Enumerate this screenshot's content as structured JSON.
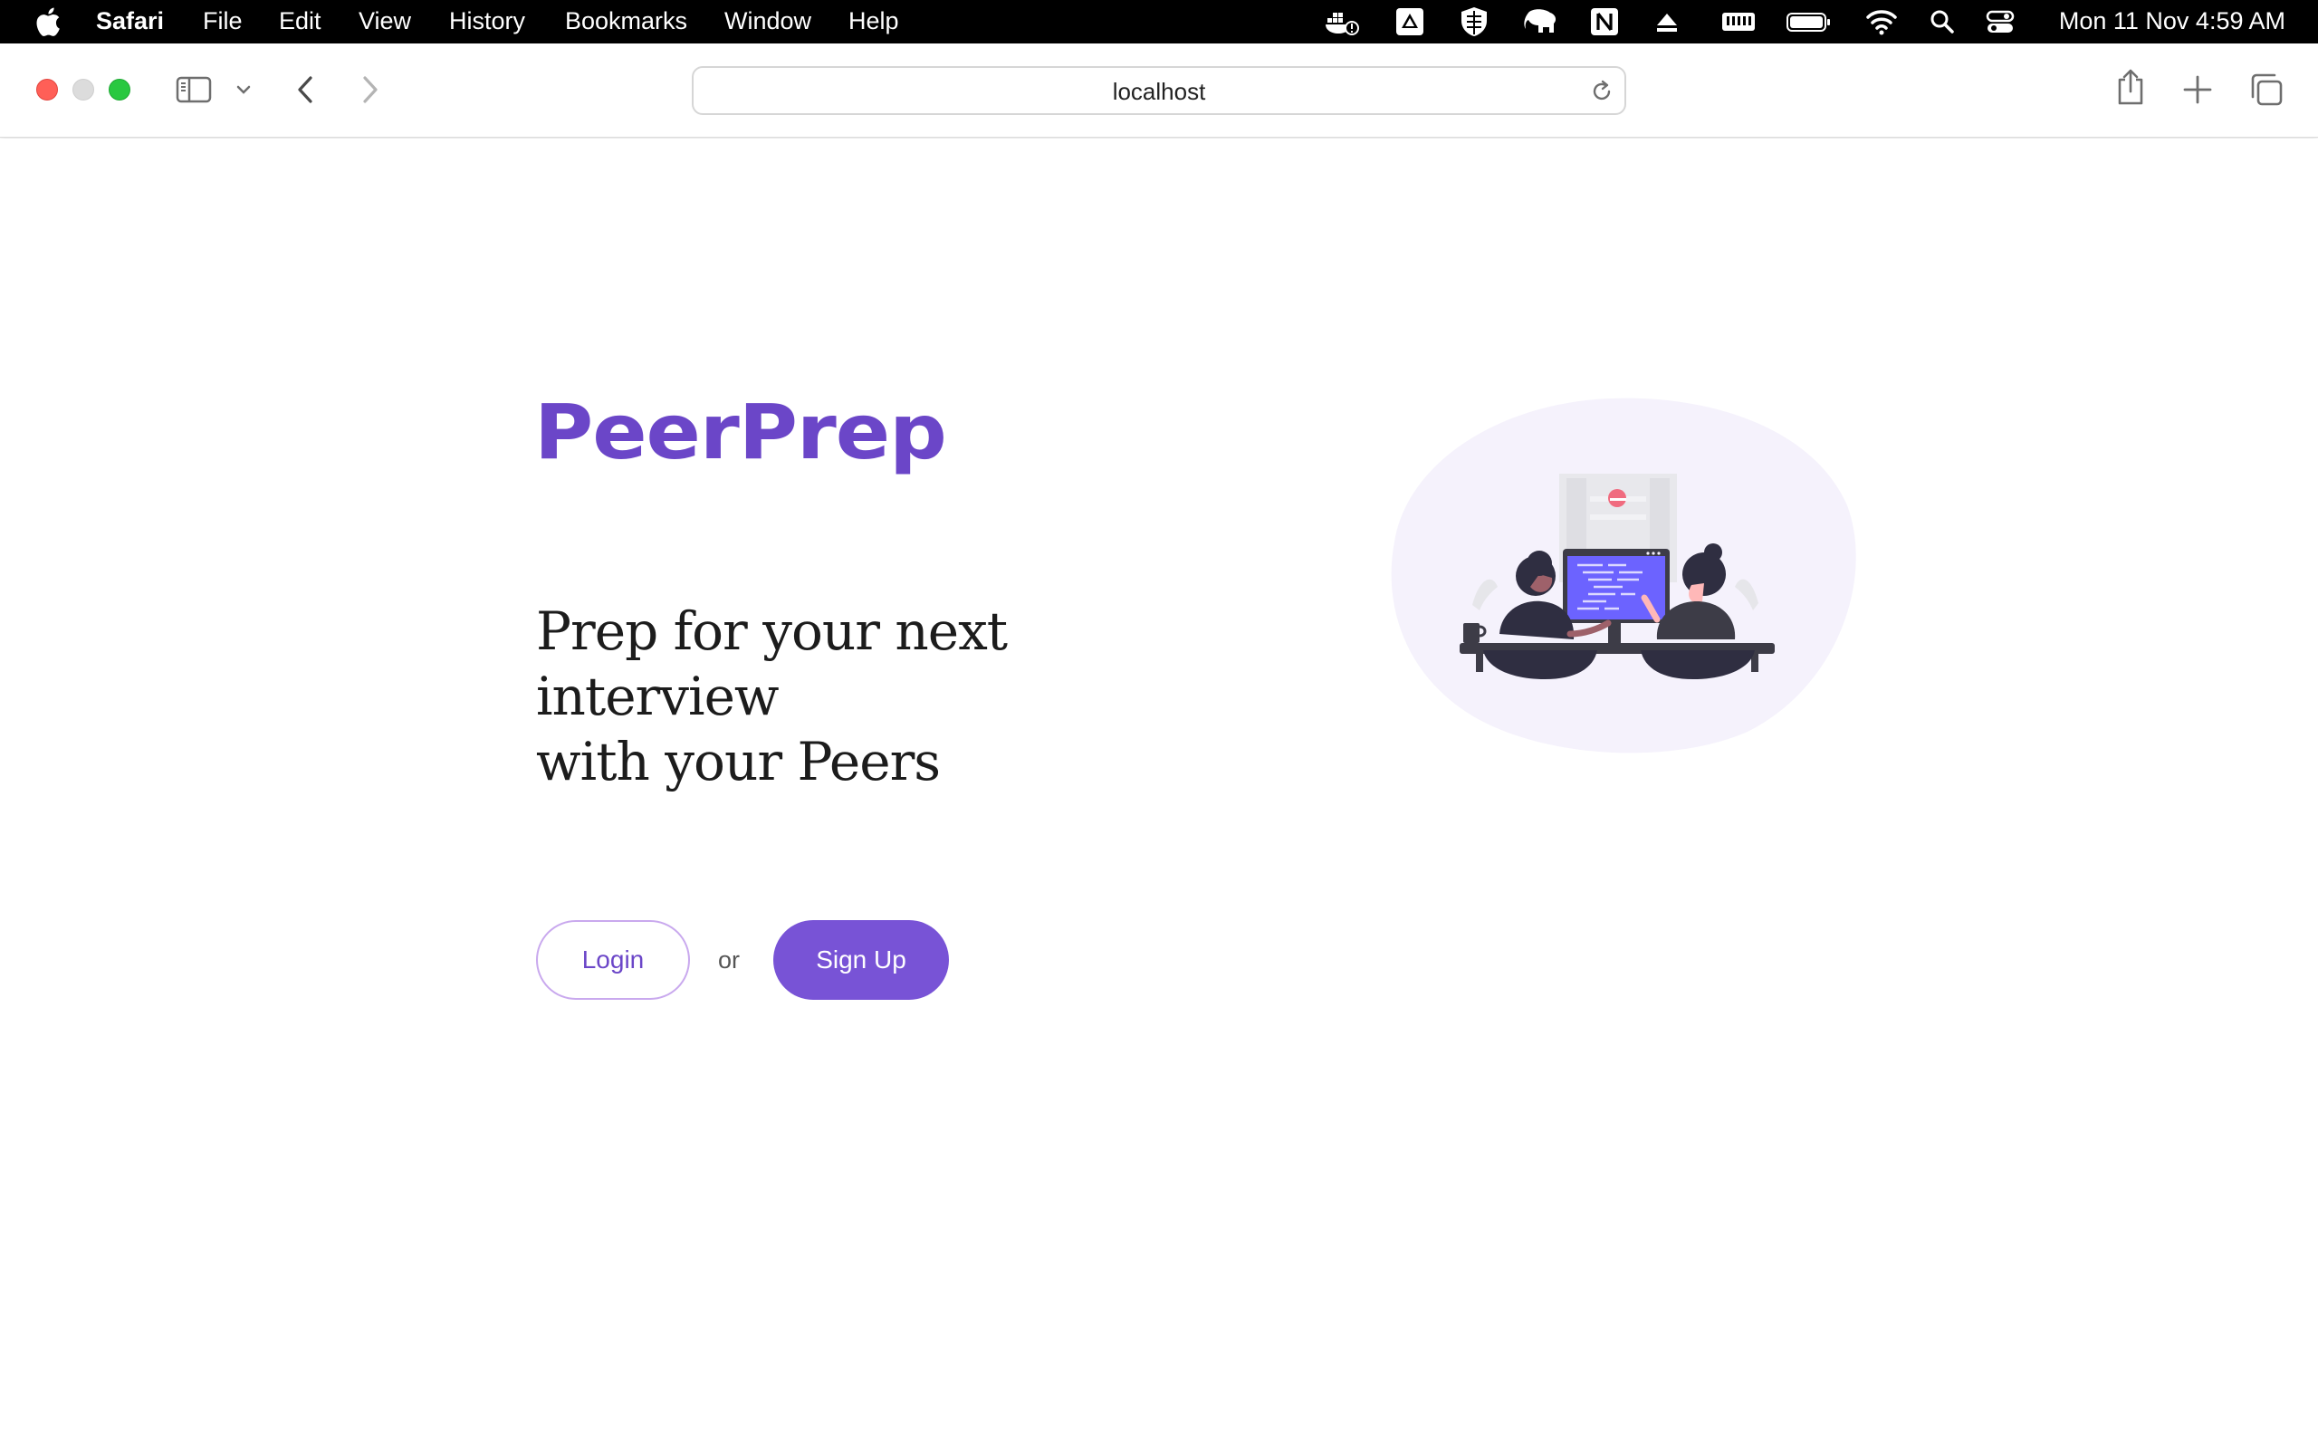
{
  "menubar": {
    "apple_icon": "apple-logo",
    "items": [
      "Safari",
      "File",
      "Edit",
      "View",
      "History",
      "Bookmarks",
      "Window",
      "Help"
    ],
    "status_icons": [
      "docker-icon",
      "drive-icon",
      "vpn-icon",
      "tableplus-elephant-icon",
      "notion-icon",
      "eject-icon",
      "memory-icon",
      "battery-icon",
      "wifi-icon",
      "search-icon",
      "control-center-icon"
    ],
    "clock": "Mon 11 Nov  4:59 AM"
  },
  "browser": {
    "url": "localhost",
    "toolbar_icons": [
      "sidebar-icon",
      "chevron-down-icon",
      "back-icon",
      "forward-icon",
      "reload-icon",
      "share-icon",
      "new-tab-icon",
      "tabs-overview-icon"
    ]
  },
  "page": {
    "brand": "PeerPrep",
    "tagline_line1": "Prep for your next interview",
    "tagline_line2": "with your Peers",
    "login_label": "Login",
    "or_label": "or",
    "signup_label": "Sign Up",
    "hero_illustration": "two-people-pair-programming"
  },
  "colors": {
    "brand": "#6b46c8",
    "primary_button": "#7853d6",
    "login_border": "#c9a9ee",
    "hero_background": "#f5f2fc"
  }
}
